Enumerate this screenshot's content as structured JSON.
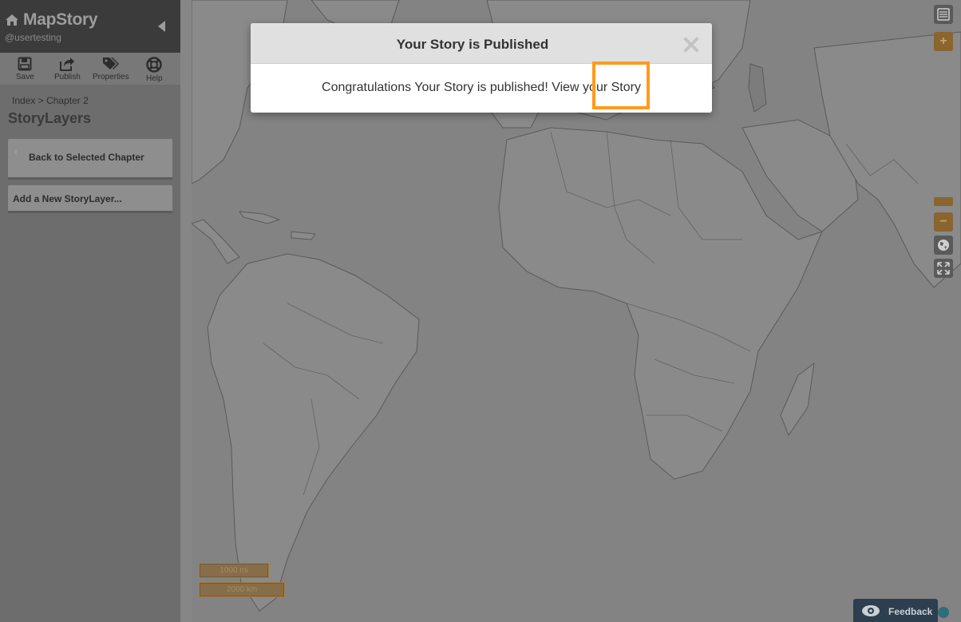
{
  "sidebar": {
    "app_title": "MapStory",
    "username": "@usertesting",
    "toolbar": [
      {
        "label": "Save",
        "icon": "save-icon"
      },
      {
        "label": "Publish",
        "icon": "share-icon"
      },
      {
        "label": "Properties",
        "icon": "tags-icon"
      },
      {
        "label": "Help",
        "icon": "lifebuoy-icon"
      }
    ],
    "breadcrumb": {
      "index": "Index",
      "sep": ">",
      "current": "Chapter 2"
    },
    "heading": "StoryLayers",
    "back_button": "Back to Selected Chapter",
    "add_layer_button": "Add a New StoryLayer..."
  },
  "map": {
    "scale_mi": "1000 mi",
    "scale_km": "2000 km"
  },
  "map_controls": {
    "zoom_in": "+",
    "zoom_out": "−"
  },
  "feedback": {
    "label": "Feedback"
  },
  "modal": {
    "title": "Your Story is Published",
    "message_prefix": "Congratulations Your Story is published! View your",
    "link_label": "Story"
  },
  "colors": {
    "accent": "#ff9a1e",
    "brand_orange": "#8a6530"
  }
}
